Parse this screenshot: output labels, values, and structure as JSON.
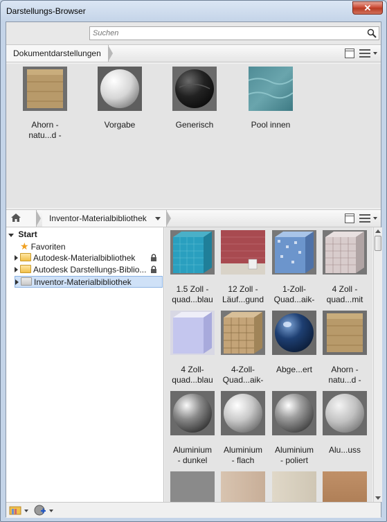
{
  "window": {
    "title": "Darstellungs-Browser",
    "close_label": "✕"
  },
  "search": {
    "placeholder": "Suchen"
  },
  "document_bar": {
    "breadcrumb": "Dokumentdarstellungen"
  },
  "document_items": [
    {
      "label": "Ahorn -\nnatu...d -",
      "icon": "wood-cube"
    },
    {
      "label": "Vorgabe",
      "icon": "white-sphere"
    },
    {
      "label": "Generisch",
      "icon": "black-sphere"
    },
    {
      "label": "Pool innen",
      "icon": "water-swatch"
    }
  ],
  "library_bar": {
    "breadcrumb": "Inventor-Materialbibliothek"
  },
  "tree": {
    "root": "Start",
    "items": [
      {
        "label": "Favoriten",
        "icon": "star-icon"
      },
      {
        "label": "Autodesk-Materialbibliothek",
        "icon": "folder-icon",
        "locked": true
      },
      {
        "label": "Autodesk Darstellungs-Biblio...",
        "icon": "folder-icon",
        "locked": true
      },
      {
        "label": "Inventor-Materialbibliothek",
        "icon": "folder-icon",
        "selected": true
      }
    ]
  },
  "materials": [
    {
      "label": "1.5 Zoll -\nquad...blau",
      "icon": "blue-tile-cube"
    },
    {
      "label": "12 Zoll -\nLäuf...gund",
      "icon": "brick-wall"
    },
    {
      "label": "1-Zoll-\nQuad...aik-",
      "icon": "mosaic-cube"
    },
    {
      "label": "4 Zoll -\nquad...mit",
      "icon": "white-tile-cube"
    },
    {
      "label": "4 Zoll-\nquad...blau",
      "icon": "lavender-cube"
    },
    {
      "label": "4-Zoll-\nQuad...aik-",
      "icon": "tan-tile-cube"
    },
    {
      "label": "Abge...ert",
      "icon": "dark-blue-sphere"
    },
    {
      "label": "Ahorn -\nnatu...d -",
      "icon": "wood-cube"
    },
    {
      "label": "Aluminium\n- dunkel",
      "icon": "metal-sphere"
    },
    {
      "label": "Aluminium\n- flach",
      "icon": "metal-sphere"
    },
    {
      "label": "Aluminium\n- poliert",
      "icon": "metal-sphere"
    },
    {
      "label": "Alu...uss",
      "icon": "metal-sphere"
    }
  ]
}
